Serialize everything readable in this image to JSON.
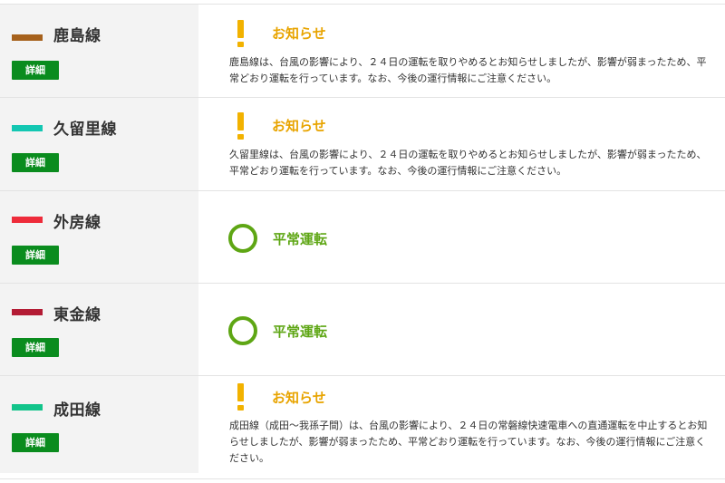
{
  "detail_label": "詳細",
  "lines": [
    {
      "name": "鹿島線",
      "color": "#a6611c",
      "status_type": "notice",
      "status_label": "お知らせ",
      "message": "鹿島線は、台風の影響により、２４日の運転を取りやめるとお知らせしましたが、影響が弱まったため、平常どおり運転を行っています。なお、今後の運行情報にご注意ください。"
    },
    {
      "name": "久留里線",
      "color": "#13c7b2",
      "status_type": "notice",
      "status_label": "お知らせ",
      "message": "久留里線は、台風の影響により、２４日の運転を取りやめるとお知らせしましたが、影響が弱まったため、平常どおり運転を行っています。なお、今後の運行情報にご注意ください。"
    },
    {
      "name": "外房線",
      "color": "#ee2b3a",
      "status_type": "normal",
      "status_label": "平常運転",
      "message": ""
    },
    {
      "name": "東金線",
      "color": "#b31b34",
      "status_type": "normal",
      "status_label": "平常運転",
      "message": ""
    },
    {
      "name": "成田線",
      "color": "#12c48a",
      "status_type": "notice",
      "status_label": "お知らせ",
      "message": "成田線（成田～我孫子間）は、台風の影響により、２４日の常磐線快速電車への直通運転を中止するとお知らせしましたが、影響が弱まったため、平常どおり運転を行っています。なお、今後の運行情報にご注意ください。"
    }
  ],
  "icons": {
    "notice": "exclamation-icon",
    "normal": "circle-icon"
  },
  "colors": {
    "detail_button": "#0a8c1e",
    "notice": "#e8a400",
    "normal": "#5ea614"
  }
}
